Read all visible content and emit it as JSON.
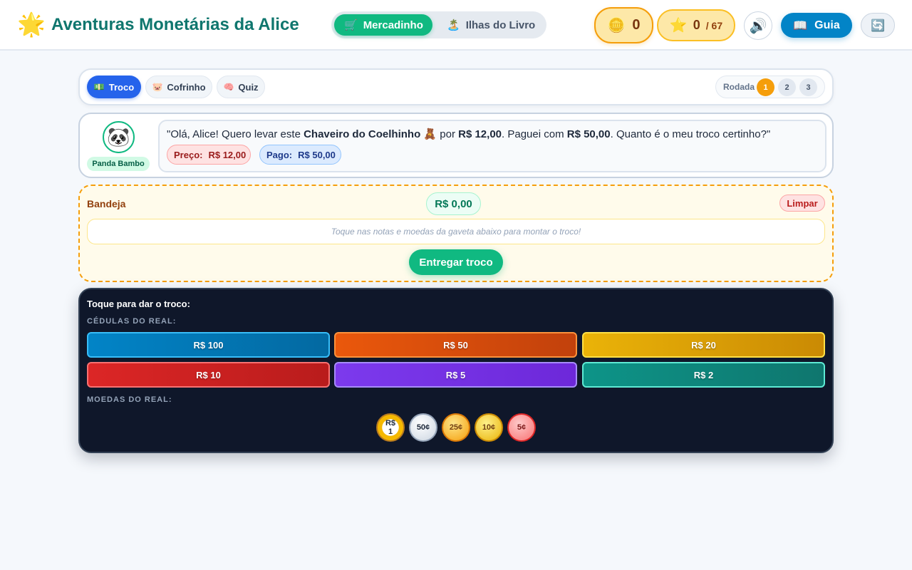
{
  "header": {
    "logo_icon": "🌟",
    "title": "Aventuras Monetárias da Alice",
    "modes": [
      {
        "icon": "🛒",
        "label": "Mercadinho",
        "active": true
      },
      {
        "icon": "🏝️",
        "label": "Ilhas do Livro",
        "active": false
      }
    ],
    "coins": {
      "icon": "🪙",
      "value": "0"
    },
    "stars": {
      "icon": "⭐",
      "value": "0",
      "total": "/ 67"
    },
    "sound_icon": "🔊",
    "guide": {
      "icon": "📖",
      "label": "Guia"
    },
    "reset_icon": "🔄"
  },
  "tabs": [
    {
      "icon": "💵",
      "label": "Troco",
      "active": true
    },
    {
      "icon": "🐷",
      "label": "Cofrinho",
      "active": false
    },
    {
      "icon": "🧠",
      "label": "Quiz",
      "active": false
    }
  ],
  "rounds": {
    "label": "Rodada",
    "items": [
      "1",
      "2",
      "3"
    ],
    "current": "1"
  },
  "customer": {
    "avatar": "🐼",
    "name": "Panda Bambo",
    "speech": {
      "p1": "\"Olá, Alice! Quero levar este ",
      "item": "Chaveiro do Coelhinho 🧸",
      "p2": " por ",
      "price": "R$ 12,00",
      "p3": ". Paguei com ",
      "paid": "R$ 50,00",
      "p4": ". Quanto é o meu troco certinho?\""
    },
    "price_tag": {
      "label": "Preço:",
      "value": "R$ 12,00"
    },
    "paid_tag": {
      "label": "Pago:",
      "value": "R$ 50,00"
    }
  },
  "tray": {
    "label": "Bandeja",
    "total": "R$ 0,00",
    "clear_label": "Limpar",
    "hint": "Toque nas notas e moedas da gaveta abaixo para montar o troco!",
    "deliver_label": "Entregar troco"
  },
  "drawer": {
    "title": "Toque para dar o troco:",
    "notes_label": "CÉDULAS DO REAL:",
    "notes": [
      "R$ 100",
      "R$ 50",
      "R$ 20",
      "R$ 10",
      "R$ 5",
      "R$ 2"
    ],
    "coins_label": "MOEDAS DO REAL:",
    "coins": [
      {
        "top": "R$",
        "bottom": "1"
      },
      {
        "top": "50¢",
        "bottom": ""
      },
      {
        "top": "25¢",
        "bottom": ""
      },
      {
        "top": "10¢",
        "bottom": ""
      },
      {
        "top": "5¢",
        "bottom": ""
      }
    ]
  },
  "colors": {
    "primary_green": "#10b981",
    "primary_blue": "#2563eb",
    "accent_amber": "#f59e0b",
    "drawer_bg": "#0f172a"
  }
}
